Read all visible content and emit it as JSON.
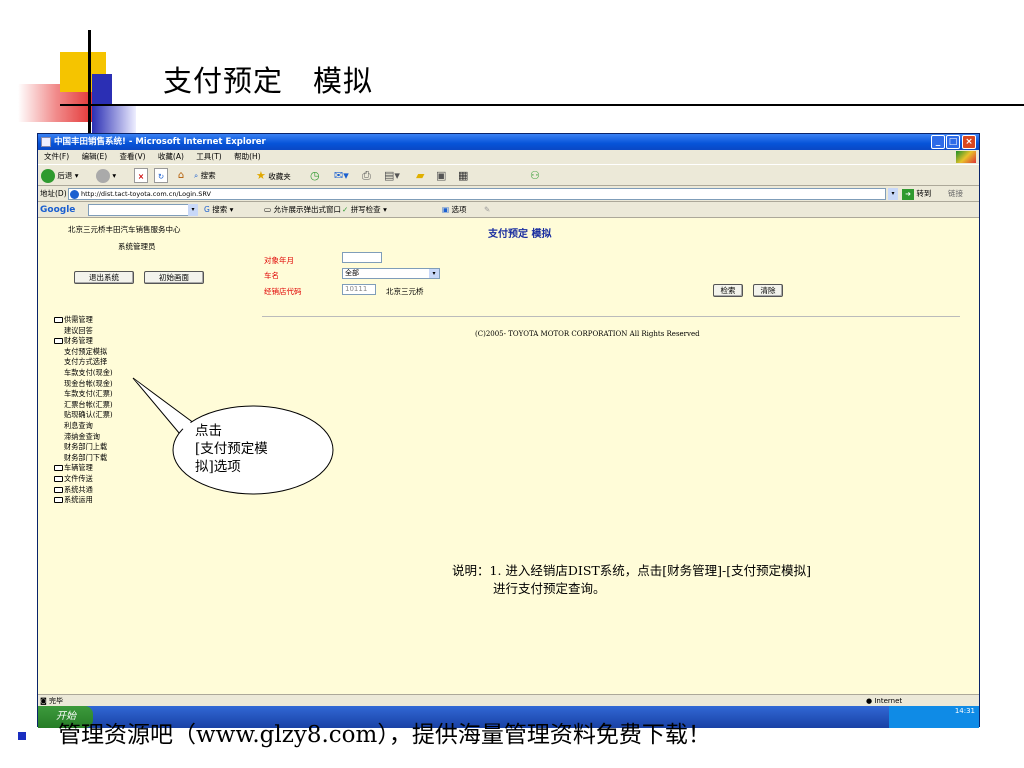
{
  "slide": {
    "title": "支付预定　模拟",
    "footer": "管理资源吧（www.glzy8.com），提供海量管理资料免费下载！"
  },
  "browser": {
    "window_title": "中国丰田销售系统! - Microsoft Internet Explorer",
    "menu": [
      "文件(F)",
      "编辑(E)",
      "查看(V)",
      "收藏(A)",
      "工具(T)",
      "帮助(H)"
    ],
    "toolbar": {
      "back": "后退",
      "search": "搜索",
      "favorites": "收藏夹"
    },
    "address": {
      "label": "地址(D)",
      "url": "http://dist.tact-toyota.com.cn/Login.SRV",
      "go": "转到",
      "links": "链接"
    },
    "google_bar": {
      "logo": "Google",
      "search": "搜索",
      "popup": "允许展示弹出式窗口",
      "spell": "拼写检查",
      "options": "选项"
    },
    "status": {
      "left": "完毕",
      "right": "Internet"
    },
    "taskbar": {
      "start": "开始",
      "time": "14:31"
    }
  },
  "page": {
    "dealer": "北京三元桥丰田汽车销售服务中心",
    "role": "系统管理员",
    "logout_button": "退出系统",
    "home_button": "初始画面",
    "form_title": "支付预定  模拟",
    "fields": {
      "month_label": "对象年月",
      "month_value": "",
      "car_label": "车名",
      "car_value": "全部",
      "dealer_code_label": "经销店代码",
      "dealer_code_value": "10111",
      "dealer_name": "北京三元桥"
    },
    "search_button": "检索",
    "clear_button": "清除",
    "copyright": "(C)2005- TOYOTA MOTOR CORPORATION All Rights Reserved",
    "tree": [
      {
        "label": "供需管理",
        "kind": "folder-open"
      },
      {
        "label": "建议回答",
        "kind": "child"
      },
      {
        "label": "财务管理",
        "kind": "folder-open"
      },
      {
        "label": "支付预定模拟",
        "kind": "child"
      },
      {
        "label": "支付方式选择",
        "kind": "child"
      },
      {
        "label": "车款支付(现金)",
        "kind": "child"
      },
      {
        "label": "现金台帐(现金)",
        "kind": "child"
      },
      {
        "label": "车款支付(汇票)",
        "kind": "child"
      },
      {
        "label": "汇票台帐(汇票)",
        "kind": "child"
      },
      {
        "label": "贴现确认(汇票)",
        "kind": "child"
      },
      {
        "label": "利息查询",
        "kind": "child"
      },
      {
        "label": "滞纳金查询",
        "kind": "child"
      },
      {
        "label": "财务部门上载",
        "kind": "child"
      },
      {
        "label": "财务部门下载",
        "kind": "child"
      },
      {
        "label": "车辆管理",
        "kind": "folder"
      },
      {
        "label": "文件传送",
        "kind": "folder"
      },
      {
        "label": "系统共通",
        "kind": "folder"
      },
      {
        "label": "系统运用",
        "kind": "folder"
      }
    ]
  },
  "callout": {
    "line1": "点击",
    "line2": "[支付预定模",
    "line3": "拟]选项"
  },
  "note": {
    "line1": "说明：1. 进入经销店DIST系统，点击[财务管理]-[支付预定模拟]",
    "line2": "进行支付预定查询。"
  }
}
